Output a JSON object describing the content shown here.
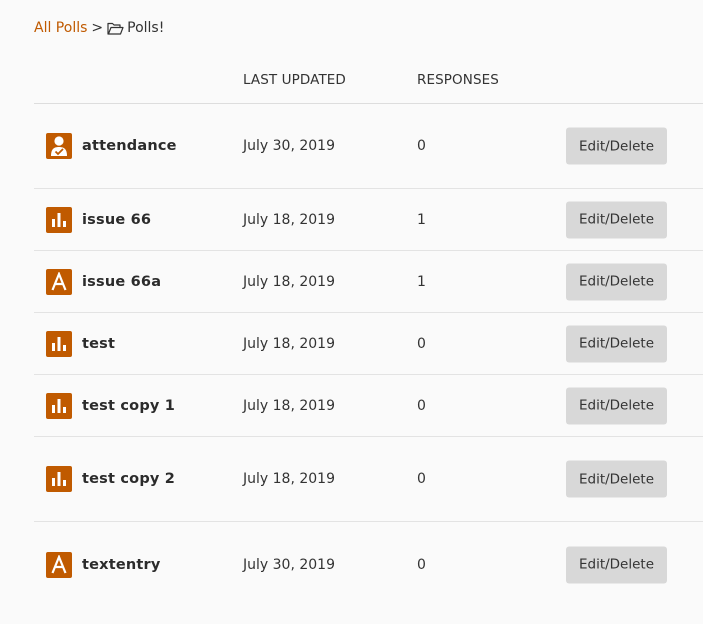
{
  "breadcrumb": {
    "root_label": "All Polls",
    "separator": ">",
    "current_label": "Polls!"
  },
  "table": {
    "columns": {
      "name": "",
      "last_updated": "LAST UPDATED",
      "responses": "RESPONSES",
      "actions": ""
    },
    "rows": [
      {
        "icon": "user-check-icon",
        "name": "attendance",
        "last_updated": "July 30, 2019",
        "responses": "0",
        "action_label": "Edit/Delete"
      },
      {
        "icon": "bar-chart-icon",
        "name": "issue 66",
        "last_updated": "July 18, 2019",
        "responses": "1",
        "action_label": "Edit/Delete"
      },
      {
        "icon": "text-entry-icon",
        "name": "issue 66a",
        "last_updated": "July 18, 2019",
        "responses": "1",
        "action_label": "Edit/Delete"
      },
      {
        "icon": "bar-chart-icon",
        "name": "test",
        "last_updated": "July 18, 2019",
        "responses": "0",
        "action_label": "Edit/Delete"
      },
      {
        "icon": "bar-chart-icon",
        "name": "test copy 1",
        "last_updated": "July 18, 2019",
        "responses": "0",
        "action_label": "Edit/Delete"
      },
      {
        "icon": "bar-chart-icon",
        "name": "test copy 2",
        "last_updated": "July 18, 2019",
        "responses": "0",
        "action_label": "Edit/Delete"
      },
      {
        "icon": "text-entry-icon",
        "name": "textentry",
        "last_updated": "July 30, 2019",
        "responses": "0",
        "action_label": "Edit/Delete"
      }
    ]
  },
  "colors": {
    "accent": "#c05a00",
    "button_bg": "#d8d8d8",
    "background": "#fafafa"
  }
}
